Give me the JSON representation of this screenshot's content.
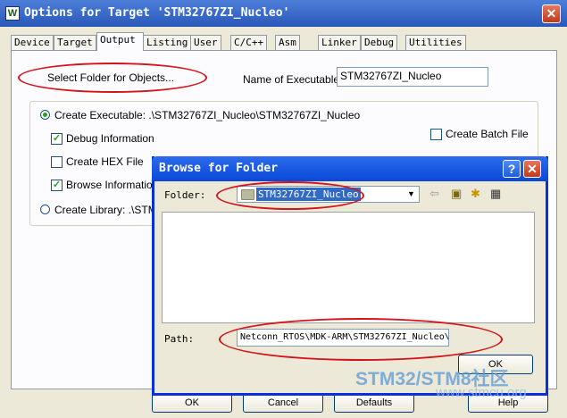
{
  "options_dialog": {
    "title": "Options for Target 'STM32767ZI_Nucleo'",
    "close_glyph": "✕",
    "app_icon_glyph": "W",
    "tabs": [
      {
        "label": "Device"
      },
      {
        "label": "Target"
      },
      {
        "label": "Output"
      },
      {
        "label": "Listing"
      },
      {
        "label": "User"
      },
      {
        "label": "C/C++"
      },
      {
        "label": "Asm"
      },
      {
        "label": "Linker"
      },
      {
        "label": "Debug"
      },
      {
        "label": "Utilities"
      }
    ],
    "active_tab": "Output",
    "select_folder_button": "Select Folder for Objects...",
    "name_of_executable_label": "Name of Executable:",
    "name_of_executable_value": "STM32767ZI_Nucleo",
    "create_executable_label": "Create Executable:  .\\STM32767ZI_Nucleo\\STM32767ZI_Nucleo",
    "debug_information_label": "Debug Information",
    "create_hex_file_label": "Create HEX File",
    "browse_information_label": "Browse Information",
    "create_library_label": "Create Library:  .\\STM3",
    "create_batch_file_label": "Create Batch File",
    "check_mark": "✓",
    "ok_label": "OK",
    "cancel_label": "Cancel",
    "defaults_label": "Defaults",
    "help_label": "Help"
  },
  "browse_dialog": {
    "title": "Browse for Folder",
    "help_glyph": "?",
    "close_glyph": "✕",
    "folder_label": "Folder:",
    "folder_value": "STM32767ZI_Nucleo",
    "dropdown_glyph": "▼",
    "path_label": "Path:",
    "path_value": "Netconn_RTOS\\MDK-ARM\\STM32767ZI_Nucleo\\",
    "ok_label": "OK",
    "toolbar_icons": [
      {
        "name": "back-arrow-icon",
        "glyph": "⇦"
      },
      {
        "name": "up-folder-icon",
        "glyph": "▣"
      },
      {
        "name": "new-folder-icon",
        "glyph": "✱"
      },
      {
        "name": "view-menu-icon",
        "glyph": "▦"
      }
    ]
  },
  "watermark": {
    "line1": "STM32/STM8社区",
    "line2": "www.stmcu.org"
  },
  "colors": {
    "annotation_red": "#d4131b",
    "title_blue": "#0a47d8",
    "selection_blue": "#316ac5"
  }
}
